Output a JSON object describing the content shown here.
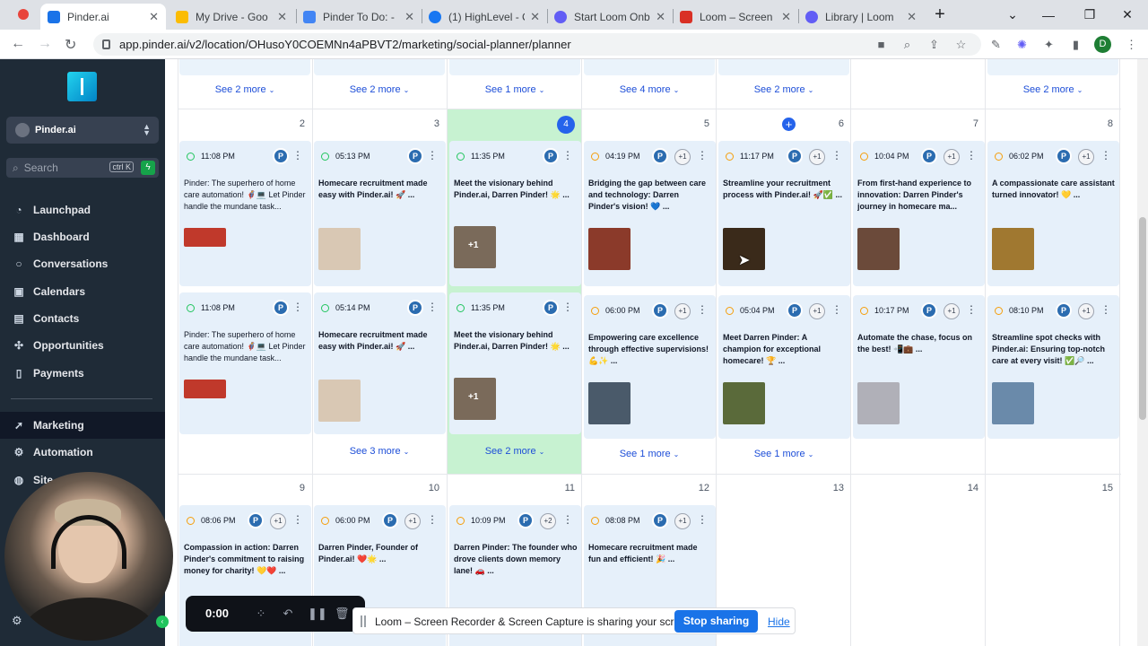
{
  "browser": {
    "tabs": [
      {
        "title": "Pinder.ai",
        "active": true,
        "color": "#1a73e8"
      },
      {
        "title": "My Drive - Goo",
        "color": "#fbbc04"
      },
      {
        "title": "Pinder To Do: -",
        "color": "#4285f4"
      },
      {
        "title": "(1) HighLevel - C",
        "color": "#1877f2"
      },
      {
        "title": "Start Loom Onb",
        "color": "#625df5"
      },
      {
        "title": "Loom – Screen R",
        "color": "#d93025"
      },
      {
        "title": "Library | Loom",
        "color": "#625df5"
      }
    ],
    "new_tab": "+",
    "url": "app.pinder.ai/v2/location/OHusoY0COEMNn4aPBVT2/marketing/social-planner/planner",
    "profile_initial": "D"
  },
  "sidebar": {
    "location_name": "Pinder.ai",
    "search_placeholder": "Search",
    "search_shortcut": "ctrl K",
    "items": [
      {
        "label": "Launchpad",
        "icon": "rocket-icon"
      },
      {
        "label": "Dashboard",
        "icon": "grid-icon"
      },
      {
        "label": "Conversations",
        "icon": "chat-icon"
      },
      {
        "label": "Calendars",
        "icon": "calendar-icon"
      },
      {
        "label": "Contacts",
        "icon": "contacts-icon"
      },
      {
        "label": "Opportunities",
        "icon": "opportunities-icon"
      },
      {
        "label": "Payments",
        "icon": "payments-icon"
      },
      {
        "label": "Marketing",
        "icon": "marketing-icon",
        "active": true
      },
      {
        "label": "Automation",
        "icon": "automation-icon"
      },
      {
        "label": "Site",
        "icon": "sites-icon"
      }
    ]
  },
  "calendar": {
    "top_see_more": [
      "See 2 more",
      "See 2 more",
      "See 1 more",
      "See 4 more",
      "See 2 more",
      "",
      "See 2 more"
    ],
    "week2": {
      "days": [
        "2",
        "3",
        "4",
        "5",
        "6",
        "7",
        "8"
      ],
      "row1": [
        {
          "time": "11:08 PM",
          "status": "published",
          "text": "Pinder: The superhero of home care automation! 🦸‍♂️💻 Let Pinder handle the mundane task...",
          "bold": false,
          "extra": "",
          "thumb": "#c0392b"
        },
        {
          "time": "05:13 PM",
          "status": "published",
          "text": "Homecare recruitment made easy with Pinder.ai! 🚀 ...",
          "bold": true,
          "extra": "",
          "thumb": "#d9c8b4"
        },
        {
          "time": "11:35 PM",
          "status": "published",
          "text": "Meet the visionary behind Pinder.ai, Darren Pinder! 🌟 ...",
          "bold": true,
          "extra": "",
          "thumb": "#7a6a5a",
          "thumb_badge": "+1"
        },
        {
          "time": "04:19 PM",
          "status": "scheduled",
          "text": "Bridging the gap between care and technology: Darren Pinder's vision! 💙 ...",
          "bold": true,
          "extra": "+1",
          "thumb": "#8b3a2a"
        },
        {
          "time": "11:17 PM",
          "status": "scheduled",
          "text": "Streamline your recruitment process with Pinder.ai! 🚀✅ ...",
          "bold": true,
          "extra": "+1",
          "thumb": "#3a2a1a"
        },
        {
          "time": "10:04 PM",
          "status": "scheduled",
          "text": "From first-hand experience to innovation: Darren Pinder's journey in homecare ma...",
          "bold": true,
          "extra": "+1",
          "thumb": "#6b4a3a"
        },
        {
          "time": "06:02 PM",
          "status": "scheduled",
          "text": "A compassionate care assistant turned innovator! 💛 ...",
          "bold": true,
          "extra": "+1",
          "thumb": "#a07830"
        }
      ],
      "row2": [
        {
          "time": "11:08 PM",
          "status": "published",
          "text": "Pinder: The superhero of home care automation! 🦸‍♂️💻 Let Pinder handle the mundane task...",
          "bold": false,
          "extra": "",
          "thumb": "#c0392b"
        },
        {
          "time": "05:14 PM",
          "status": "published",
          "text": "Homecare recruitment made easy with Pinder.ai! 🚀 ...",
          "bold": true,
          "extra": "",
          "thumb": "#d9c8b4"
        },
        {
          "time": "11:35 PM",
          "status": "published",
          "text": "Meet the visionary behind Pinder.ai, Darren Pinder! 🌟 ...",
          "bold": true,
          "extra": "",
          "thumb": "#7a6a5a",
          "thumb_badge": "+1"
        },
        {
          "time": "06:00 PM",
          "status": "scheduled",
          "text": "Empowering care excellence through effective supervisions! 💪✨ ...",
          "bold": true,
          "extra": "+1",
          "thumb": "#4a5a6a"
        },
        {
          "time": "05:04 PM",
          "status": "scheduled",
          "text": "Meet Darren Pinder: A champion for exceptional homecare! 🏆 ...",
          "bold": true,
          "extra": "+1",
          "thumb": "#5a6a3a"
        },
        {
          "time": "10:17 PM",
          "status": "scheduled",
          "text": "Automate the chase, focus on the best! 📲💼 ...",
          "bold": true,
          "extra": "+1",
          "thumb": "#b0b0b8"
        },
        {
          "time": "08:10 PM",
          "status": "scheduled",
          "text": "Streamline spot checks with Pinder.ai: Ensuring top-notch care at every visit! ✅🔎 ...",
          "bold": true,
          "extra": "+1",
          "thumb": "#6a8aaa"
        }
      ],
      "see_more": [
        "",
        "See 3 more",
        "See 2 more",
        "See 1 more",
        "See 1 more",
        "",
        ""
      ]
    },
    "week3": {
      "days": [
        "9",
        "10",
        "11",
        "12",
        "13",
        "14",
        "15"
      ],
      "row1": [
        {
          "time": "08:06 PM",
          "status": "scheduled",
          "text": "Compassion in action: Darren Pinder's commitment to raising money for charity! 💛❤️ ...",
          "bold": true,
          "extra": "+1"
        },
        {
          "time": "06:00 PM",
          "status": "scheduled",
          "text": "Darren Pinder, Founder of Pinder.ai! ❤️🌟 ...",
          "bold": true,
          "extra": "+1"
        },
        {
          "time": "10:09 PM",
          "status": "scheduled",
          "text": "Darren Pinder: The founder who drove clients down memory lane! 🚗 ...",
          "bold": true,
          "extra": "+2"
        },
        {
          "time": "08:08 PM",
          "status": "scheduled",
          "text": "Homecare recruitment made fun and efficient! 🎉 ...",
          "bold": true,
          "extra": "+1"
        }
      ]
    }
  },
  "loom": {
    "timer": "0:00",
    "share_message": "Loom – Screen Recorder & Screen Capture is sharing your screen.",
    "stop_label": "Stop sharing",
    "hide_label": "Hide"
  }
}
